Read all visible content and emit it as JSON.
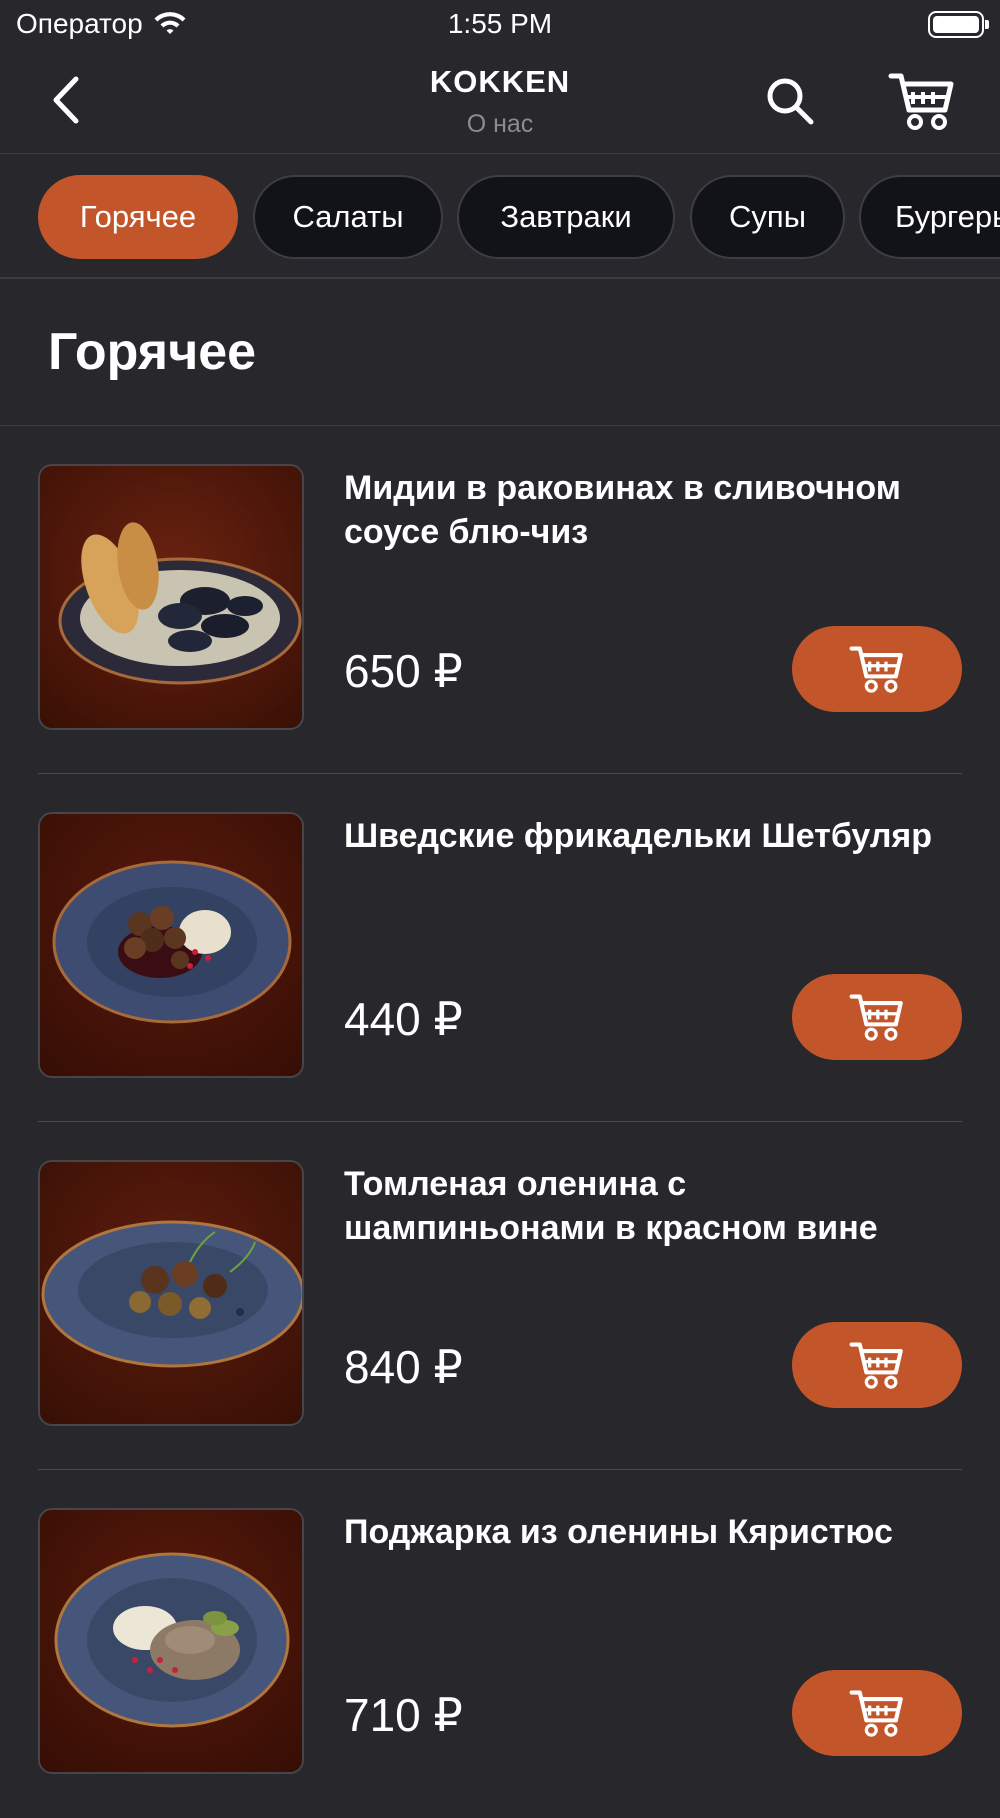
{
  "status_bar": {
    "carrier": "Оператор",
    "time": "1:55 PM"
  },
  "navbar": {
    "title": "KOKKEN",
    "subtitle": "О нас"
  },
  "categories": [
    {
      "label": "Горячее",
      "active": true
    },
    {
      "label": "Салаты",
      "active": false
    },
    {
      "label": "Завтраки",
      "active": false
    },
    {
      "label": "Супы",
      "active": false
    },
    {
      "label": "Бургеры",
      "active": false
    }
  ],
  "section": {
    "title": "Горячее"
  },
  "products": [
    {
      "name": "Мидии в раковинах в сливочном соусе блю-чиз",
      "price": "650 ₽"
    },
    {
      "name": "Шведские фрикадельки Шетбуляр",
      "price": "440 ₽"
    },
    {
      "name": "Томленая оленина с шампиньонами  в красном вине",
      "price": "840 ₽"
    },
    {
      "name": "Поджарка из оленины Кяристюс",
      "price": "710 ₽"
    }
  ],
  "colors": {
    "background": "#27272c",
    "accent": "#c2562a",
    "chip_inactive": "#121318",
    "muted_text": "#8b8b90"
  },
  "icons": {
    "back": "chevron-left-icon",
    "search": "search-icon",
    "cart": "cart-icon",
    "wifi": "wifi-icon",
    "battery": "battery-icon"
  }
}
